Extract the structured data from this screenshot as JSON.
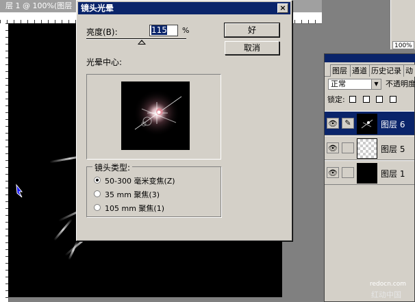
{
  "document": {
    "title": "层 1 @ 100%(图层"
  },
  "navigator": {
    "zoom": "100%"
  },
  "layers_panel": {
    "tabs": [
      {
        "label": "图层"
      },
      {
        "label": "通道"
      },
      {
        "label": "历史记录"
      },
      {
        "label": "动"
      }
    ],
    "blend_mode": "正常",
    "opacity_label": "不透明度",
    "lock_label": "锁定:",
    "layers": [
      {
        "name": "图层 6",
        "selected": true,
        "thumb": "flare"
      },
      {
        "name": "图层 5",
        "selected": false,
        "thumb": "transparent"
      },
      {
        "name": "图层 1",
        "selected": false,
        "thumb": "black"
      }
    ]
  },
  "dialog": {
    "title": "镜头光晕",
    "close": "×",
    "brightness_label": "亮度(B):",
    "brightness_value": "115",
    "brightness_unit": "%",
    "brightness_level_percent": 115,
    "ok_label": "好",
    "cancel_label": "取消",
    "flare_center_label": "光晕中心:",
    "lens_type_label": "镜头类型:",
    "lens_options": [
      {
        "label": "50-300 毫米变焦(Z)",
        "checked": true
      },
      {
        "label": "35 mm 聚焦(3)",
        "checked": false
      },
      {
        "label": "105 mm 聚焦(1)",
        "checked": false
      }
    ]
  },
  "watermark": {
    "line1": "redocn.com",
    "line2": "红动中国"
  }
}
